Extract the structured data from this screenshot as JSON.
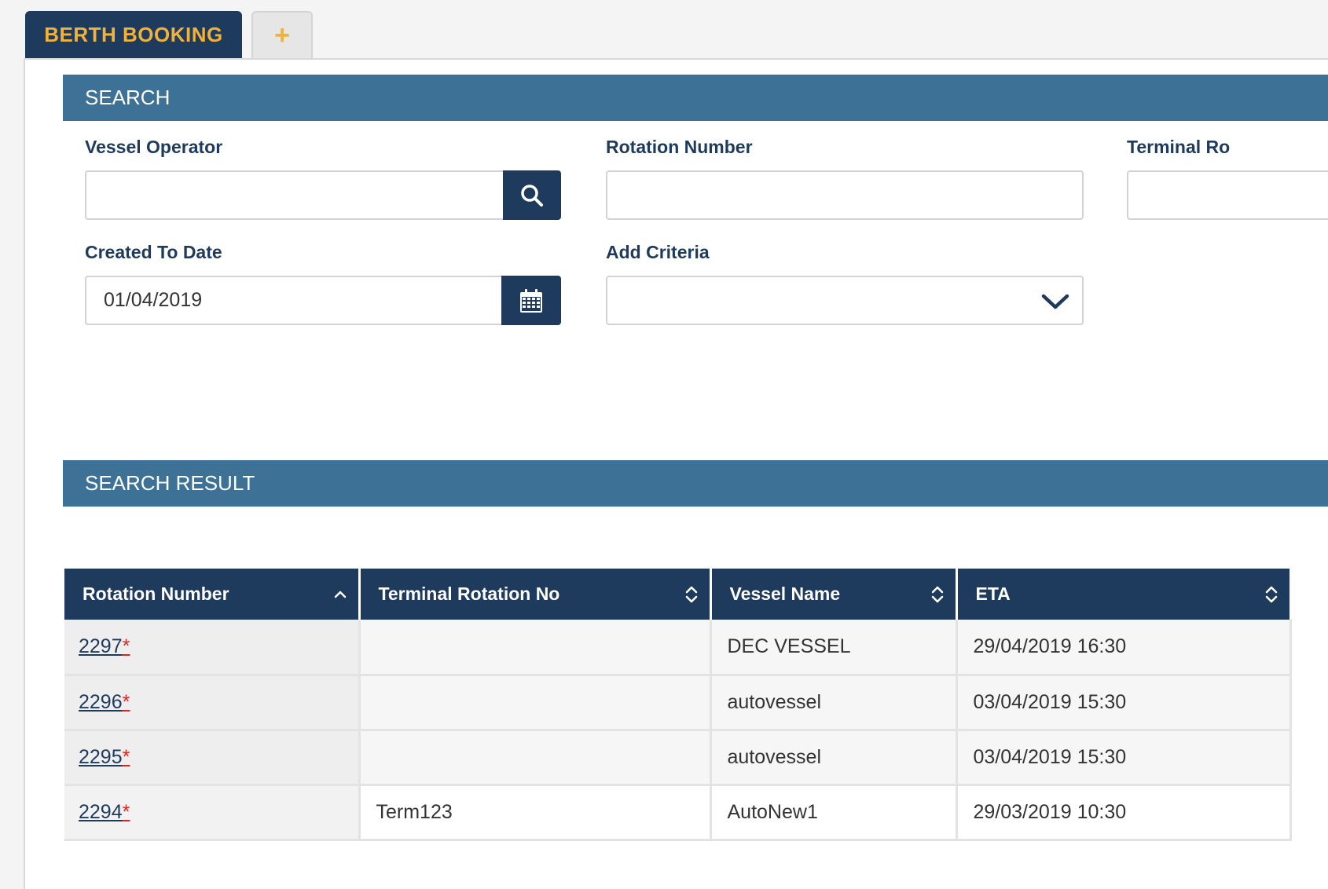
{
  "tabs": {
    "active_label": "BERTH BOOKING",
    "add_label": "+"
  },
  "search": {
    "title": "SEARCH",
    "vessel_operator_label": "Vessel Operator",
    "vessel_operator_value": "",
    "rotation_number_label": "Rotation Number",
    "rotation_number_value": "",
    "terminal_rotation_label": "Terminal Ro",
    "created_to_date_label": "Created To Date",
    "created_to_date_value": "01/04/2019",
    "add_criteria_label": "Add Criteria",
    "add_criteria_value": ""
  },
  "results": {
    "title": "SEARCH RESULT",
    "columns": [
      "Rotation Number",
      "Terminal Rotation No",
      "Vessel Name",
      "ETA"
    ],
    "rows": [
      {
        "rotation": "2297",
        "flag": "*",
        "terminal": "",
        "vessel": "DEC VESSEL",
        "eta": "29/04/2019 16:30"
      },
      {
        "rotation": "2296",
        "flag": "*",
        "terminal": "",
        "vessel": "autovessel",
        "eta": "03/04/2019 15:30"
      },
      {
        "rotation": "2295",
        "flag": "*",
        "terminal": "",
        "vessel": "autovessel",
        "eta": "03/04/2019 15:30"
      },
      {
        "rotation": "2294",
        "flag": "*",
        "terminal": "Term123",
        "vessel": "AutoNew1",
        "eta": "29/03/2019 10:30"
      }
    ]
  },
  "colors": {
    "navy": "#1e3a5c",
    "section_blue": "#3d7296",
    "accent_orange": "#f0b23a",
    "required_red": "#d9261c"
  }
}
